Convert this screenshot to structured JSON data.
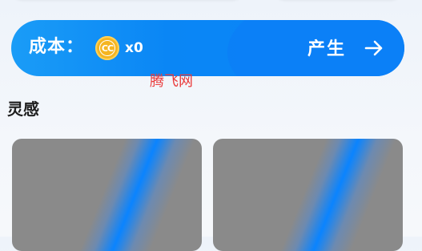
{
  "cost": {
    "label": "成本：",
    "coin_icon": "coin-icon",
    "coin_icon_text": "CC",
    "count": "x0"
  },
  "generate": {
    "label": "产生",
    "icon": "arrow-right-icon"
  },
  "watermark": "腾飞网",
  "section": {
    "title": "灵感"
  },
  "colors": {
    "accent": "#0a84ff",
    "cost_bar": "#1a9cf7",
    "coin": "#f5b521",
    "watermark": "#ea3b3b",
    "placeholder": "#8a8a8a"
  }
}
